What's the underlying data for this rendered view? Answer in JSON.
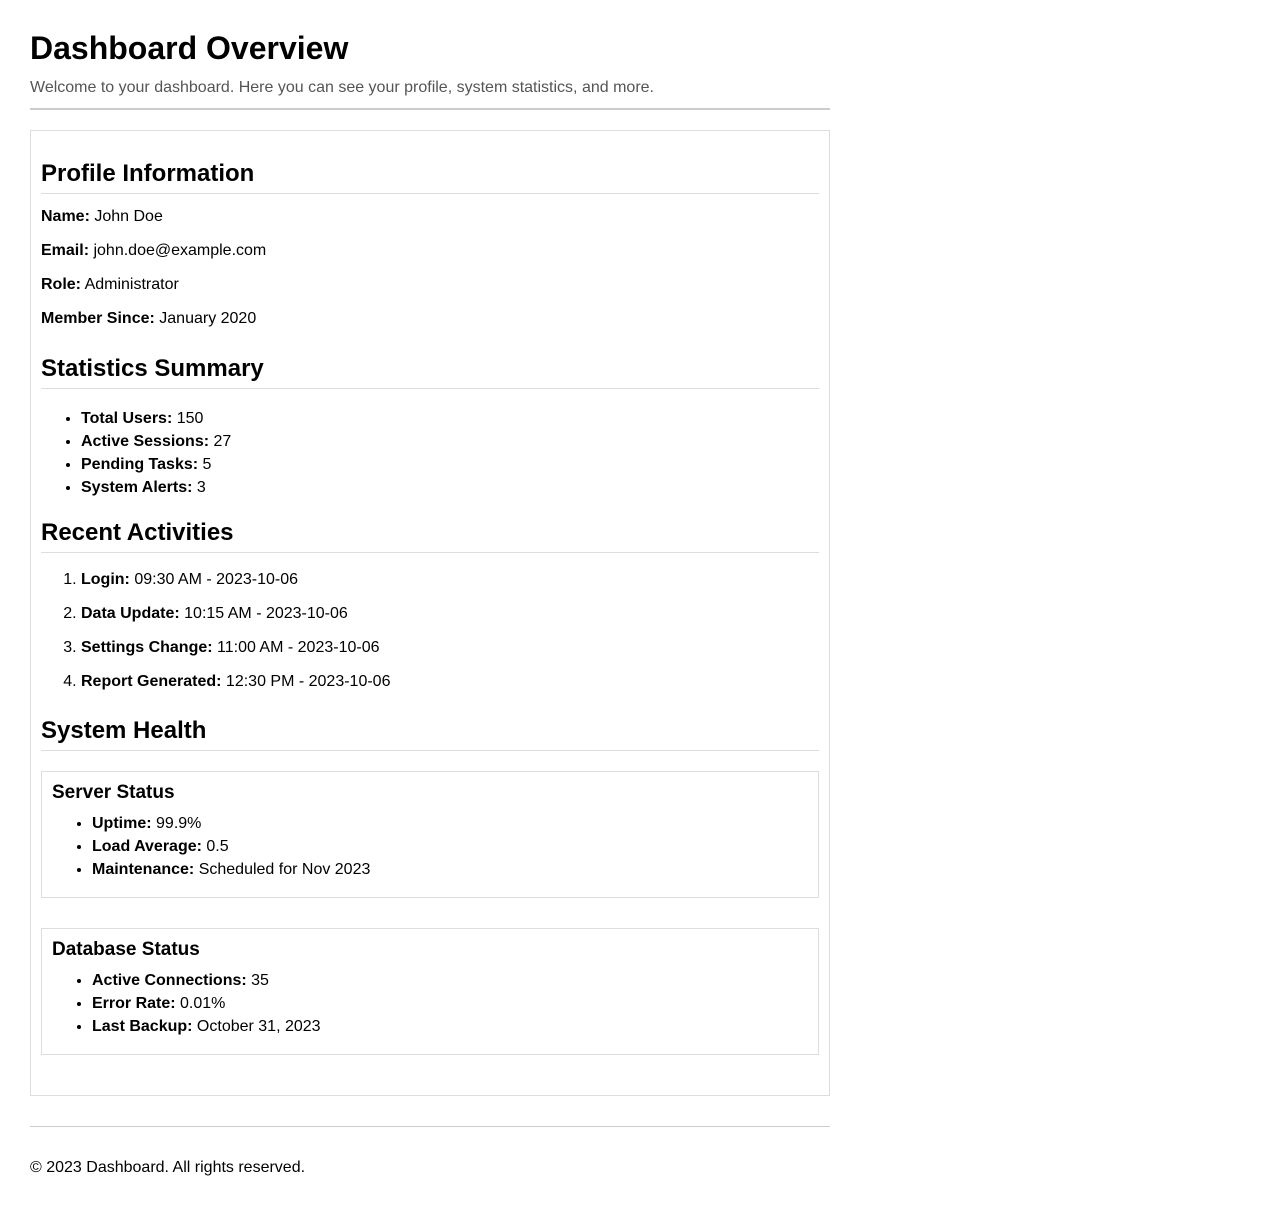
{
  "header": {
    "title": "Dashboard Overview",
    "subtitle": "Welcome to your dashboard. Here you can see your profile, system statistics, and more."
  },
  "profile": {
    "heading": "Profile Information",
    "fields": [
      {
        "label": "Name:",
        "value": "John Doe"
      },
      {
        "label": "Email:",
        "value": "john.doe@example.com"
      },
      {
        "label": "Role:",
        "value": "Administrator"
      },
      {
        "label": "Member Since:",
        "value": "January 2020"
      }
    ]
  },
  "statistics": {
    "heading": "Statistics Summary",
    "items": [
      {
        "label": "Total Users:",
        "value": "150"
      },
      {
        "label": "Active Sessions:",
        "value": "27"
      },
      {
        "label": "Pending Tasks:",
        "value": "5"
      },
      {
        "label": "System Alerts:",
        "value": "3"
      }
    ]
  },
  "activities": {
    "heading": "Recent Activities",
    "items": [
      {
        "label": "Login:",
        "value": "09:30 AM - 2023-10-06"
      },
      {
        "label": "Data Update:",
        "value": "10:15 AM - 2023-10-06"
      },
      {
        "label": "Settings Change:",
        "value": "11:00 AM - 2023-10-06"
      },
      {
        "label": "Report Generated:",
        "value": "12:30 PM - 2023-10-06"
      }
    ]
  },
  "health": {
    "heading": "System Health",
    "server": {
      "title": "Server Status",
      "items": [
        {
          "label": "Uptime:",
          "value": "99.9%"
        },
        {
          "label": "Load Average:",
          "value": "0.5"
        },
        {
          "label": "Maintenance:",
          "value": "Scheduled for Nov 2023"
        }
      ]
    },
    "database": {
      "title": "Database Status",
      "items": [
        {
          "label": "Active Connections:",
          "value": "35"
        },
        {
          "label": "Error Rate:",
          "value": "0.01%"
        },
        {
          "label": "Last Backup:",
          "value": "October 31, 2023"
        }
      ]
    }
  },
  "footer": {
    "text": "© 2023 Dashboard. All rights reserved."
  }
}
